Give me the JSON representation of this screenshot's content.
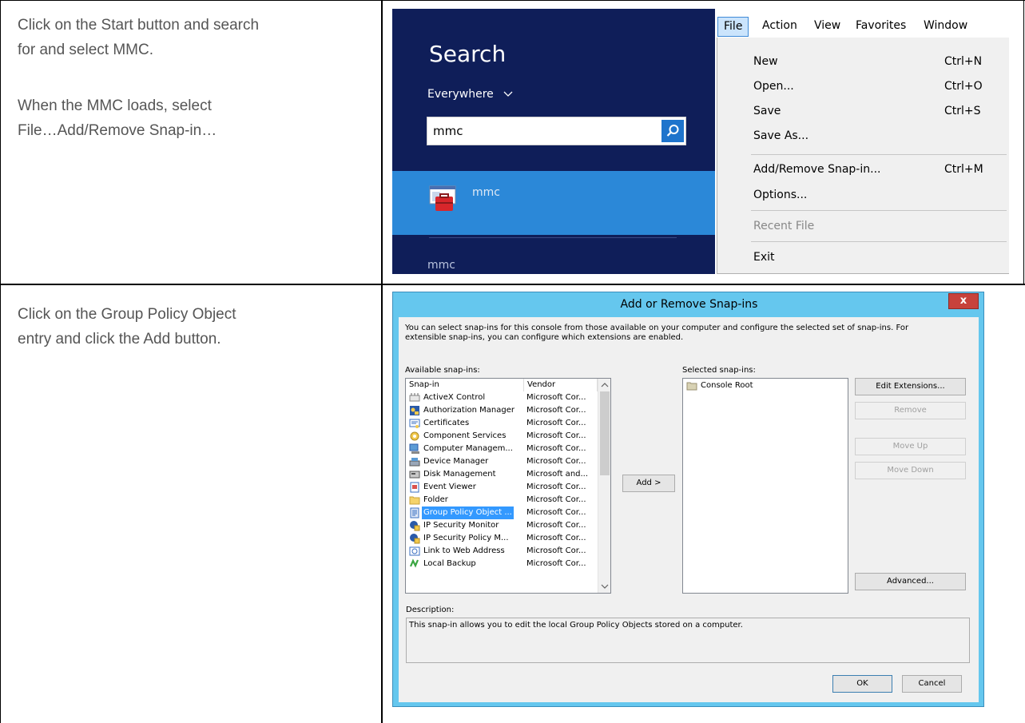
{
  "row1": {
    "instructions": [
      "Click on the Start button and search",
      "for and select MMC.",
      "When the MMC loads, select",
      "File…Add/Remove Snap-in…"
    ]
  },
  "search": {
    "title": "Search",
    "scope": "Everywhere",
    "query": "mmc",
    "result_label": "mmc",
    "footer": "mmc"
  },
  "menu": {
    "bar": [
      "File",
      "Action",
      "View",
      "Favorites",
      "Window"
    ],
    "items": [
      {
        "label": "New",
        "shortcut": "Ctrl+N"
      },
      {
        "label": "Open...",
        "shortcut": "Ctrl+O"
      },
      {
        "label": "Save",
        "shortcut": "Ctrl+S"
      },
      {
        "label": "Save As...",
        "shortcut": ""
      },
      {
        "label": "Add/Remove Snap-in...",
        "shortcut": "Ctrl+M"
      },
      {
        "label": "Options...",
        "shortcut": ""
      },
      {
        "label": "Recent File",
        "shortcut": ""
      },
      {
        "label": "Exit",
        "shortcut": ""
      }
    ]
  },
  "row2": {
    "instructions": [
      "Click on the Group Policy Object",
      "entry and click the Add button."
    ]
  },
  "dialog": {
    "title": "Add or Remove Snap-ins",
    "close": "x",
    "intro_line1": "You can select snap-ins for this console from those available on your computer and configure the selected set of snap-ins. For",
    "intro_line2": "extensible snap-ins, you can configure which extensions are enabled.",
    "available_label": "Available snap-ins:",
    "selected_label": "Selected snap-ins:",
    "col_snapin": "Snap-in",
    "col_vendor": "Vendor",
    "snapins": [
      {
        "name": "ActiveX Control",
        "vendor": "Microsoft Cor..."
      },
      {
        "name": "Authorization Manager",
        "vendor": "Microsoft Cor..."
      },
      {
        "name": "Certificates",
        "vendor": "Microsoft Cor..."
      },
      {
        "name": "Component Services",
        "vendor": "Microsoft Cor..."
      },
      {
        "name": "Computer Managem...",
        "vendor": "Microsoft Cor..."
      },
      {
        "name": "Device Manager",
        "vendor": "Microsoft Cor..."
      },
      {
        "name": "Disk Management",
        "vendor": "Microsoft and..."
      },
      {
        "name": "Event Viewer",
        "vendor": "Microsoft Cor..."
      },
      {
        "name": "Folder",
        "vendor": "Microsoft Cor..."
      },
      {
        "name": "Group Policy Object ...",
        "vendor": "Microsoft Cor..."
      },
      {
        "name": "IP Security Monitor",
        "vendor": "Microsoft Cor..."
      },
      {
        "name": "IP Security Policy M...",
        "vendor": "Microsoft Cor..."
      },
      {
        "name": "Link to Web Address",
        "vendor": "Microsoft Cor..."
      },
      {
        "name": "Local Backup",
        "vendor": "Microsoft Cor..."
      }
    ],
    "selected_snapin": "Console Root",
    "add_button": "Add >",
    "edit_extensions": "Edit Extensions...",
    "remove": "Remove",
    "move_up": "Move Up",
    "move_down": "Move Down",
    "advanced": "Advanced...",
    "description_label": "Description:",
    "description": "This snap-in allows you to edit the local Group Policy Objects stored on a computer.",
    "ok": "OK",
    "cancel": "Cancel"
  }
}
